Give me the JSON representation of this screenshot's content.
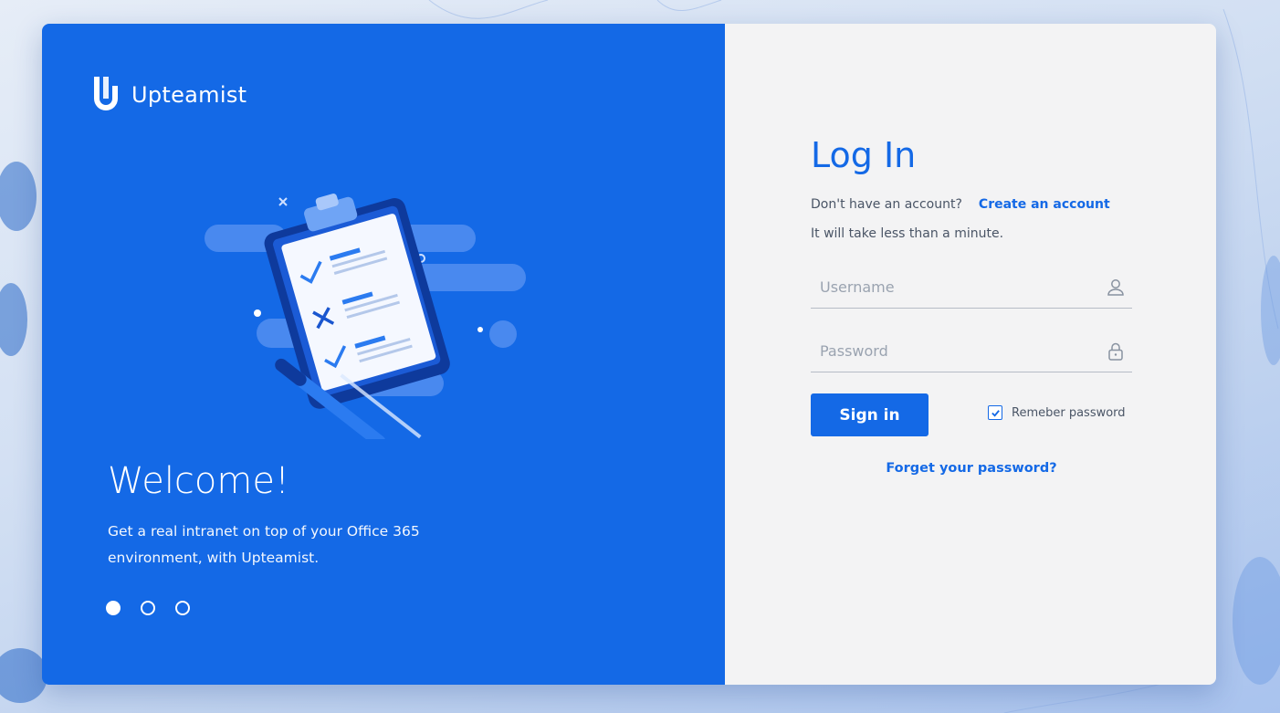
{
  "colors": {
    "brand_blue": "#1469e6",
    "panel_light": "#f3f3f4",
    "text_muted": "#4a5566"
  },
  "brand": {
    "name": "Upteamist",
    "icon": "upteamist-logo-icon"
  },
  "hero": {
    "illustration": "clipboard-checklist-illustration",
    "title": "Welcome!",
    "subtitle": "Get a real intranet on top of your Office 365 environment, with Upteamist.",
    "carousel": {
      "total": 3,
      "active": 1
    }
  },
  "login": {
    "title": "Log In",
    "prompt": "Don't have an account?",
    "create_account_link": "Create an account",
    "note": "It will take less than a minute.",
    "username": {
      "value": "",
      "placeholder": "Username",
      "icon": "user-icon"
    },
    "password": {
      "value": "",
      "placeholder": "Password",
      "icon": "lock-icon"
    },
    "signin_label": "Sign in",
    "remember": {
      "label": "Remeber password",
      "checked": true
    },
    "forgot_link": "Forget your password?"
  }
}
